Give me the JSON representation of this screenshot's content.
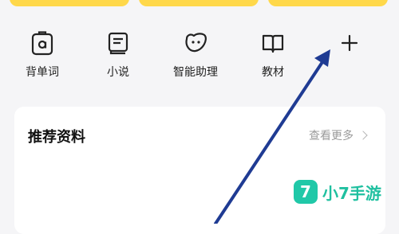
{
  "shortcuts": [
    {
      "label": "背单词",
      "icon": "vocabulary-icon"
    },
    {
      "label": "小说",
      "icon": "novel-icon"
    },
    {
      "label": "智能助理",
      "icon": "assistant-icon"
    },
    {
      "label": "教材",
      "icon": "textbook-icon"
    }
  ],
  "add_button": {
    "icon": "plus-icon"
  },
  "recommend": {
    "title": "推荐资料",
    "more": "查看更多"
  },
  "watermark": {
    "logo": "7",
    "text": "小7手游"
  },
  "colors": {
    "accent": "#ffd84a",
    "arrow": "#1f3b93",
    "watermark": "#20c0a0"
  }
}
